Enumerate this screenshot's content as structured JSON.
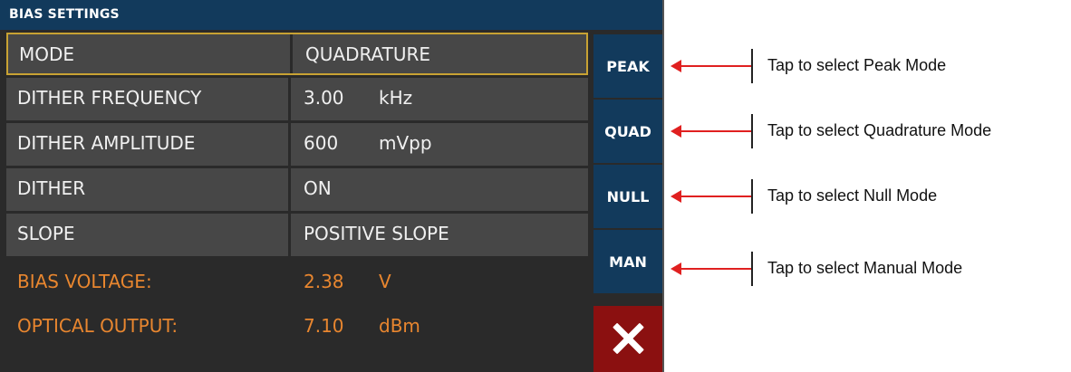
{
  "panel": {
    "title": "BIAS SETTINGS"
  },
  "rows": [
    {
      "label": "MODE",
      "value": "QUADRATURE",
      "unit": ""
    },
    {
      "label": "DITHER FREQUENCY",
      "value": "3.00",
      "unit": "kHz"
    },
    {
      "label": "DITHER AMPLITUDE",
      "value": "600",
      "unit": "mVpp"
    },
    {
      "label": "DITHER",
      "value": "ON",
      "unit": ""
    },
    {
      "label": "SLOPE",
      "value": "POSITIVE SLOPE",
      "unit": ""
    }
  ],
  "status": [
    {
      "label": "BIAS VOLTAGE:",
      "value": "2.38",
      "unit": "V"
    },
    {
      "label": "OPTICAL OUTPUT:",
      "value": "7.10",
      "unit": "dBm"
    }
  ],
  "side_buttons": [
    "PEAK",
    "QUAD",
    "NULL",
    "MAN"
  ],
  "close_icon": "close-icon",
  "callouts": [
    "Tap to select Peak Mode",
    "Tap to select Quadrature Mode",
    "Tap to select Null Mode",
    "Tap to select Manual Mode"
  ],
  "colors": {
    "title_bar": "#123a5c",
    "panel_bg": "#2a2a2a",
    "row_bg": "#474747",
    "selected_border": "#c8a233",
    "status_text": "#e8862f",
    "side_button": "#123a5c",
    "close_button": "#8b1010",
    "arrow": "#e02020"
  }
}
